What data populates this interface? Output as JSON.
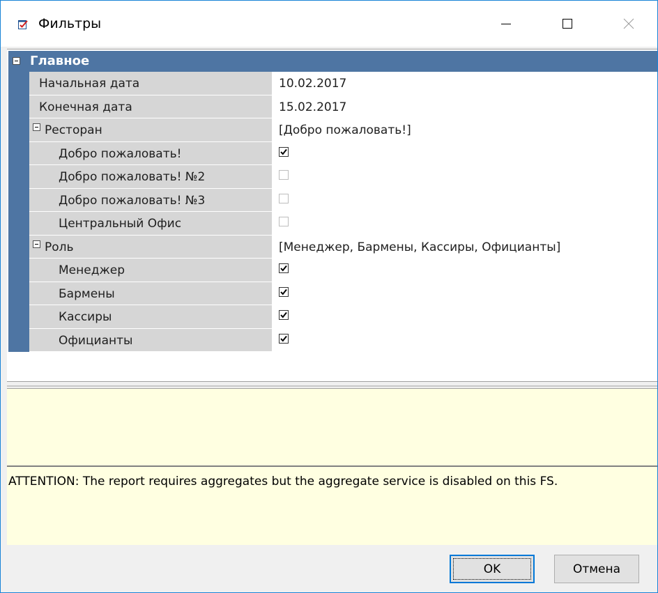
{
  "window": {
    "title": "Фильтры",
    "title_icon": "filter-form-icon"
  },
  "grid": {
    "category": "Главное",
    "rows": [
      {
        "name": "Начальная дата",
        "value": "10.02.2017"
      },
      {
        "name": "Конечная дата",
        "value": "15.02.2017"
      },
      {
        "name": "Ресторан",
        "value": "[Добро пожаловать!]"
      },
      {
        "name": "Добро пожаловать!",
        "checked": true
      },
      {
        "name": "Добро пожаловать! №2",
        "checked": false
      },
      {
        "name": "Добро пожаловать! №3",
        "checked": false
      },
      {
        "name": "Центральный Офис",
        "checked": false
      },
      {
        "name": "Роль",
        "value": "[Менеджер, Бармены, Кассиры, Официанты]"
      },
      {
        "name": "Менеджер",
        "checked": true
      },
      {
        "name": "Бармены",
        "checked": true
      },
      {
        "name": "Кассиры",
        "checked": true
      },
      {
        "name": "Официанты",
        "checked": true
      }
    ]
  },
  "message": "ATTENTION: The report requires aggregates but the aggregate service is disabled on this FS.",
  "buttons": {
    "ok": "OK",
    "cancel": "Отмена"
  },
  "colors": {
    "category_bg": "#4e75a3",
    "message_bg": "#ffffe1",
    "ok_border": "#0078d7"
  }
}
